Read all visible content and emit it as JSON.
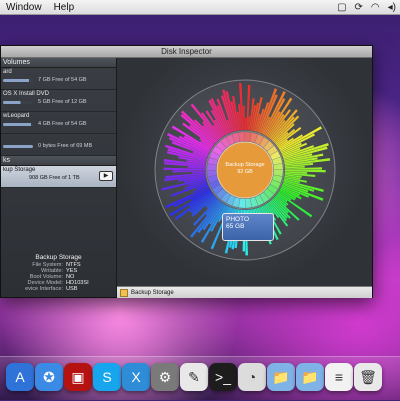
{
  "menubar": {
    "items": [
      "Window",
      "Help"
    ]
  },
  "window": {
    "title": "Disk Inspector"
  },
  "sidebar": {
    "volumes_header": "Volumes",
    "volumes": [
      {
        "name": "ard",
        "free": "7 GB Free of 54 GB",
        "fill": 0.87
      },
      {
        "name": "OS X Install DVD",
        "free": "5 GB Free of 12 GB",
        "fill": 0.58
      },
      {
        "name": "wLeopard",
        "free": "4 GB Free of 54 GB",
        "fill": 0.93
      },
      {
        "name": "",
        "free": "0 bytes Free of 69 MB",
        "fill": 1.0
      }
    ],
    "disks_header": "ks",
    "selected": {
      "name": "kup Storage",
      "free": "908 GB Free of 1 TB",
      "play": "▶"
    }
  },
  "info": {
    "title": "Backup Storage",
    "rows": [
      {
        "k": "File System:",
        "v": "NTFS"
      },
      {
        "k": "Writable:",
        "v": "YES"
      },
      {
        "k": "Boot Volume:",
        "v": "NO"
      },
      {
        "k": "Device Model:",
        "v": "HD103SI"
      },
      {
        "k": "evice Interface:",
        "v": "USB"
      }
    ]
  },
  "center_label": {
    "name": "Backup Storage",
    "size": "92 GB"
  },
  "tooltip": {
    "name": "PHOTO",
    "size": "65 GB"
  },
  "statusbar": {
    "path": "Backup Storage"
  },
  "dock_icons": [
    {
      "name": "app-store-icon",
      "color": "#2f73d8",
      "glyph": "A"
    },
    {
      "name": "safari-icon",
      "color": "#3b8be6",
      "glyph": "✪"
    },
    {
      "name": "photo-booth-icon",
      "color": "#b51212",
      "glyph": "▣"
    },
    {
      "name": "skype-icon",
      "color": "#17a6ee",
      "glyph": "S"
    },
    {
      "name": "xcode-icon",
      "color": "#2e8dd6",
      "glyph": "X"
    },
    {
      "name": "system-preferences-icon",
      "color": "#7a7a7a",
      "glyph": "⚙"
    },
    {
      "name": "notes-icon",
      "color": "#e8e8e8",
      "glyph": "✎"
    },
    {
      "name": "terminal-icon",
      "color": "#1d1d1d",
      "glyph": ">_"
    },
    {
      "name": "disk-inspector-icon",
      "color": "#dcdcdc",
      "glyph": "◔"
    },
    {
      "name": "applications-folder-icon",
      "color": "#7fb2e6",
      "glyph": "📁"
    },
    {
      "name": "documents-folder-icon",
      "color": "#7fb2e6",
      "glyph": "📁"
    },
    {
      "name": "document-icon",
      "color": "#f2f2f2",
      "glyph": "≡"
    },
    {
      "name": "trash-icon",
      "color": "#e9e9e9",
      "glyph": "🗑"
    }
  ]
}
